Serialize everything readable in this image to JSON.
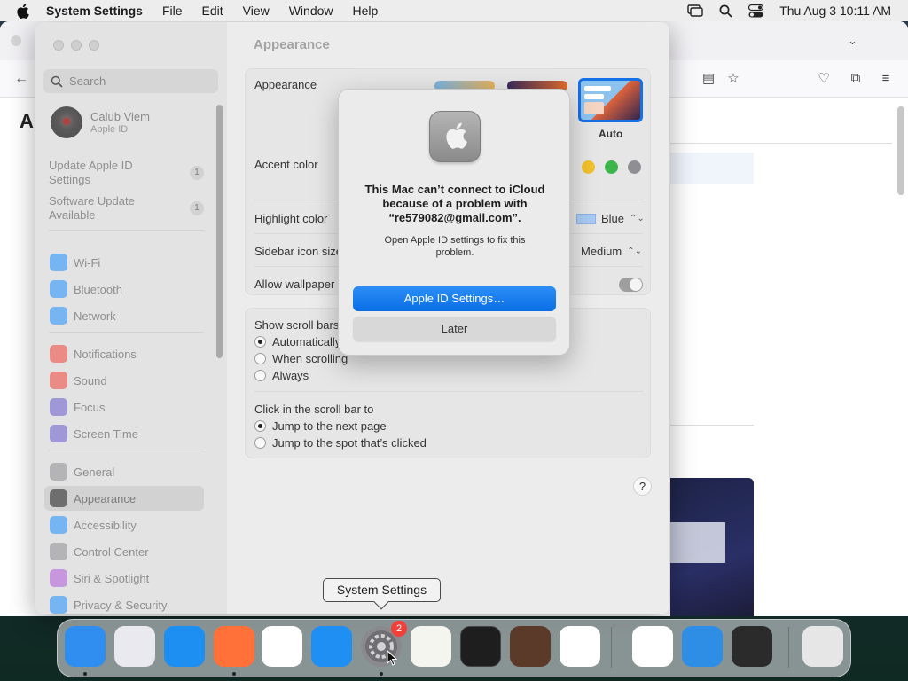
{
  "menubar": {
    "app_name": "System Settings",
    "menus": [
      "File",
      "Edit",
      "View",
      "Window",
      "Help"
    ],
    "clock": "Thu Aug 3  10:11 AM"
  },
  "browser": {
    "heading": "Ap"
  },
  "settings": {
    "search_placeholder": "Search",
    "user": {
      "name": "Calub Viem",
      "sub": "Apple ID"
    },
    "notices": [
      {
        "label": "Update Apple ID Settings",
        "count": "1"
      },
      {
        "label": "Software Update Available",
        "count": "1"
      }
    ],
    "sidebar_groups": [
      [
        {
          "label": "Wi-Fi",
          "color": "#1e90ff",
          "icon": "wifi-icon"
        },
        {
          "label": "Bluetooth",
          "color": "#1e90ff",
          "icon": "bluetooth-icon"
        },
        {
          "label": "Network",
          "color": "#1e90ff",
          "icon": "globe-icon"
        }
      ],
      [
        {
          "label": "Notifications",
          "color": "#f0443a",
          "icon": "bell-icon"
        },
        {
          "label": "Sound",
          "color": "#f0443a",
          "icon": "speaker-icon"
        },
        {
          "label": "Focus",
          "color": "#6a5acd",
          "icon": "moon-icon"
        },
        {
          "label": "Screen Time",
          "color": "#6a5acd",
          "icon": "hourglass-icon"
        }
      ],
      [
        {
          "label": "General",
          "color": "#8e8e93",
          "icon": "gear-icon"
        },
        {
          "label": "Appearance",
          "color": "#1c1c1e",
          "icon": "appearance-icon",
          "selected": true
        },
        {
          "label": "Accessibility",
          "color": "#1e90ff",
          "icon": "accessibility-icon"
        },
        {
          "label": "Control Center",
          "color": "#8e8e93",
          "icon": "control-center-icon"
        },
        {
          "label": "Siri & Spotlight",
          "color": "#b05ad8",
          "icon": "siri-icon"
        },
        {
          "label": "Privacy & Security",
          "color": "#1e90ff",
          "icon": "hand-icon"
        }
      ]
    ],
    "content": {
      "title": "Appearance",
      "appearance_label": "Appearance",
      "theme_auto_label": "Auto",
      "accent_label": "Accent color",
      "accent_colors": [
        "#f5a623",
        "#f2c12e",
        "#3cb54a",
        "#8e8e93"
      ],
      "highlight_label": "Highlight color",
      "highlight_value": "Blue",
      "highlight_swatch": "#a9cbf5",
      "sidebar_icon_label": "Sidebar icon size",
      "sidebar_icon_value": "Medium",
      "wallpaper_label": "Allow wallpaper tinting in windows",
      "scroll_label": "Show scroll bars",
      "scroll_options": [
        "Automatically based on mouse or trackpad",
        "When scrolling",
        "Always"
      ],
      "click_label": "Click in the scroll bar to",
      "click_options": [
        "Jump to the next page",
        "Jump to the spot that’s clicked"
      ],
      "help": "?"
    }
  },
  "alert": {
    "title": "This Mac can’t connect to iCloud because of a problem with “re579082@gmail.com”.",
    "message": "Open Apple ID settings to fix this problem.",
    "primary_button": "Apple ID Settings…",
    "secondary_button": "Later"
  },
  "tooltip": "System Settings",
  "dock": {
    "settings_badge": "2",
    "apps": [
      {
        "name": "finder-icon",
        "color": "#2f8ef0",
        "running": true
      },
      {
        "name": "launchpad-icon",
        "color": "#e9e9ef",
        "running": false
      },
      {
        "name": "safari-icon",
        "color": "#1d8ff2",
        "running": false
      },
      {
        "name": "firefox-icon",
        "color": "#ff7139",
        "running": true
      },
      {
        "name": "chrome-icon",
        "color": "#ffffff",
        "running": false
      },
      {
        "name": "app-store-icon",
        "color": "#1f8ff3",
        "running": false
      },
      {
        "name": "system-settings-icon",
        "color": "#8a8a8e",
        "running": true
      },
      {
        "name": "textedit-icon",
        "color": "#f5f5f0",
        "running": false
      },
      {
        "name": "terminal-icon",
        "color": "#1e1e1e",
        "running": false
      },
      {
        "name": "garageband-icon",
        "color": "#5b3a2a",
        "running": false
      },
      {
        "name": "vscode-icon",
        "color": "#ffffff",
        "running": false
      },
      {
        "name": "visual-studio-icon",
        "color": "#ffffff",
        "running": false
      },
      {
        "name": "weather-icon",
        "color": "#2e8ee6",
        "running": false
      },
      {
        "name": "quicktime-icon",
        "color": "#2b2b2b",
        "running": false
      },
      {
        "name": "trash-icon",
        "color": "#e6e6e6",
        "running": false
      }
    ]
  }
}
